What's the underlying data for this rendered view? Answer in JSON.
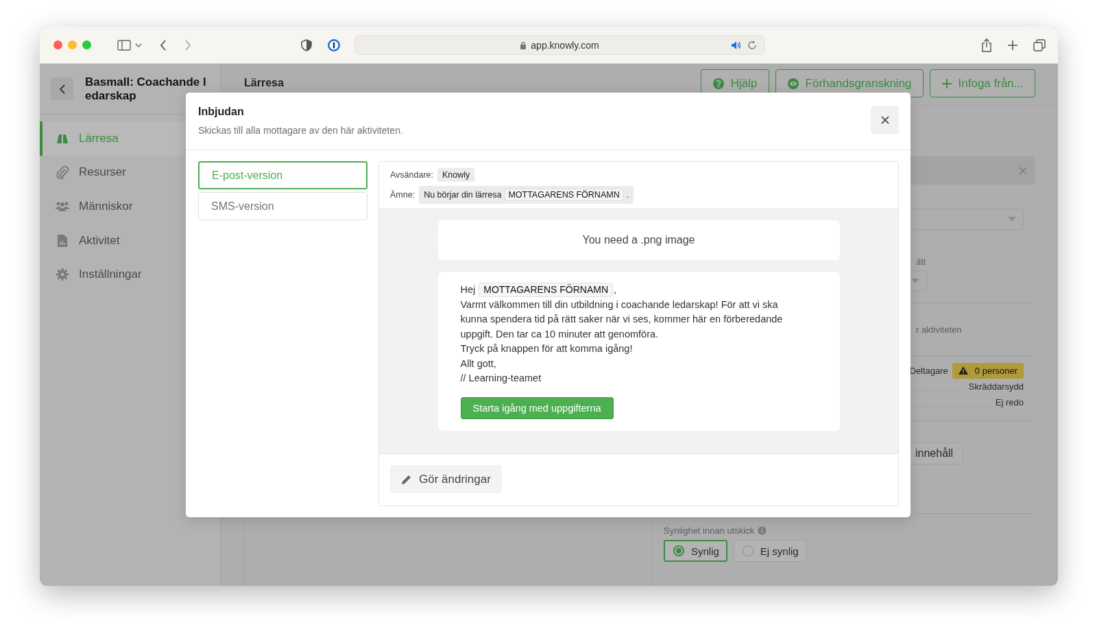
{
  "browser": {
    "url": "app.knowly.com"
  },
  "sidebar": {
    "title_lines": [
      "Basmall: Coachande l",
      "edarskap"
    ],
    "items": [
      {
        "label": "Lärresa",
        "selected": true
      },
      {
        "label": "Resurser",
        "selected": false
      },
      {
        "label": "Människor",
        "selected": false
      },
      {
        "label": "Aktivitet",
        "selected": false
      },
      {
        "label": "Inställningar",
        "selected": false
      }
    ]
  },
  "main": {
    "title": "Lärresa",
    "actions": [
      {
        "label": "Hjälp"
      },
      {
        "label": "Förhandsgranskning"
      },
      {
        "label": "Infoga från..."
      }
    ]
  },
  "panel": {
    "label_fragment": "ätt",
    "note_fragment": "r aktiviteten",
    "participants_label": "Deltagare",
    "participants_badge": "0 personer",
    "type_value": "Skräddarsydd",
    "status_value": "Ej redo",
    "content_button": "innehåll",
    "visibility_label": "Synlighet innan utskick",
    "visibility_options": [
      {
        "label": "Synlig",
        "selected": true
      },
      {
        "label": "Ej synlig",
        "selected": false
      }
    ]
  },
  "modal": {
    "title": "Inbjudan",
    "subtitle": "Skickas till alla mottagare av den här aktiviteten.",
    "tabs": [
      {
        "label": "E-post-version",
        "selected": true
      },
      {
        "label": "SMS-version",
        "selected": false
      }
    ],
    "sender_label": "Avsändare:",
    "sender": "Knowly",
    "subject_label": "Ämne:",
    "subject_text": "Nu börjar din lärresa",
    "subject_token": "MOTTAGARENS FÖRNAMN",
    "subject_end": ".",
    "image_placeholder": "You need a .png image",
    "greeting": "Hej",
    "greeting_token": "MOTTAGARENS FÖRNAMN",
    "greeting_end": ",",
    "lines": [
      "Varmt välkommen till din utbildning i coachande ledarskap! För att vi ska kunna spendera tid på rätt saker när vi ses, kommer här en förberedande uppgift. Den tar ca 10 minuter att genomföra.",
      "Tryck på knappen för att komma igång!",
      "Allt gott,",
      "// Learning-teamet"
    ],
    "cta": "Starta igång med uppgifterna",
    "edit_button": "Gör ändringar"
  }
}
